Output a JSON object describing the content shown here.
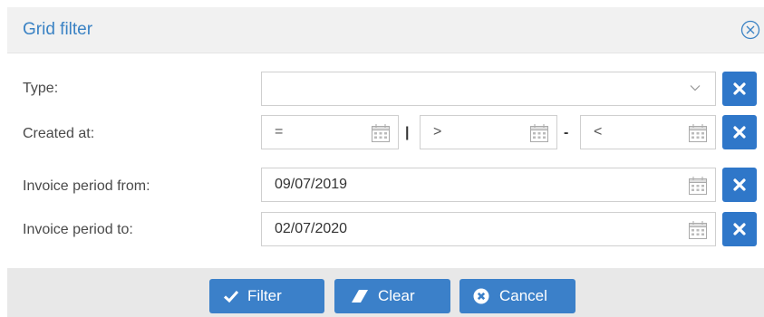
{
  "dialog": {
    "title": "Grid filter"
  },
  "rows": {
    "type": {
      "label": "Type:",
      "value": ""
    },
    "created_at": {
      "label": "Created at:",
      "eq_placeholder": "=",
      "gt_placeholder": ">",
      "lt_placeholder": "<",
      "sep1": "|",
      "sep2": "-"
    },
    "invoice_from": {
      "label": "Invoice period from:",
      "value": "09/07/2019"
    },
    "invoice_to": {
      "label": "Invoice period to:",
      "value": "02/07/2020"
    }
  },
  "buttons": {
    "filter": "Filter",
    "clear": "Clear",
    "cancel": "Cancel"
  },
  "colors": {
    "accent": "#3b80c9",
    "title": "#3a82c4"
  },
  "icons": [
    "close-circle-icon",
    "chevron-down-icon",
    "calendar-icon",
    "x-icon",
    "check-icon",
    "eraser-icon",
    "cancel-circle-icon"
  ]
}
